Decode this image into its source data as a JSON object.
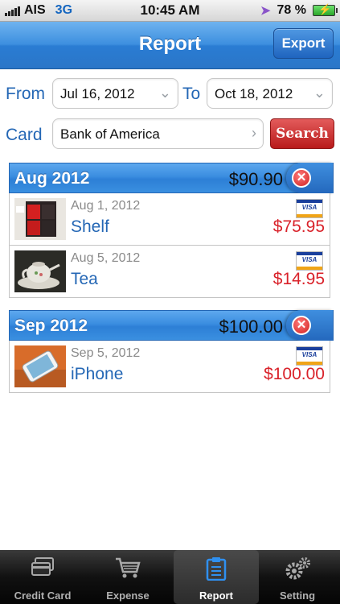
{
  "status": {
    "carrier": "AIS",
    "network": "3G",
    "time": "10:45 AM",
    "battery": "78 %"
  },
  "nav": {
    "title": "Report",
    "export_label": "Export"
  },
  "filters": {
    "from_label": "From",
    "from_value": "Jul 16, 2012",
    "to_label": "To",
    "to_value": "Oct 18, 2012",
    "card_label": "Card",
    "card_value": "Bank of America",
    "search_label": "Search"
  },
  "sections": [
    {
      "month": "Aug 2012",
      "total": "$90.90",
      "items": [
        {
          "date": "Aug 1, 2012",
          "name": "Shelf",
          "amount": "$75.95",
          "card_icon": "visa-icon"
        },
        {
          "date": "Aug 5, 2012",
          "name": "Tea",
          "amount": "$14.95",
          "card_icon": "visa-icon"
        }
      ]
    },
    {
      "month": "Sep 2012",
      "total": "$100.00",
      "items": [
        {
          "date": "Sep 5, 2012",
          "name": "iPhone",
          "amount": "$100.00",
          "card_icon": "visa-icon"
        }
      ]
    }
  ],
  "tabs": [
    {
      "label": "Credit Card",
      "icon": "credit-card-icon"
    },
    {
      "label": "Expense",
      "icon": "cart-icon"
    },
    {
      "label": "Report",
      "icon": "clipboard-icon",
      "active": true
    },
    {
      "label": "Setting",
      "icon": "gears-icon"
    }
  ]
}
